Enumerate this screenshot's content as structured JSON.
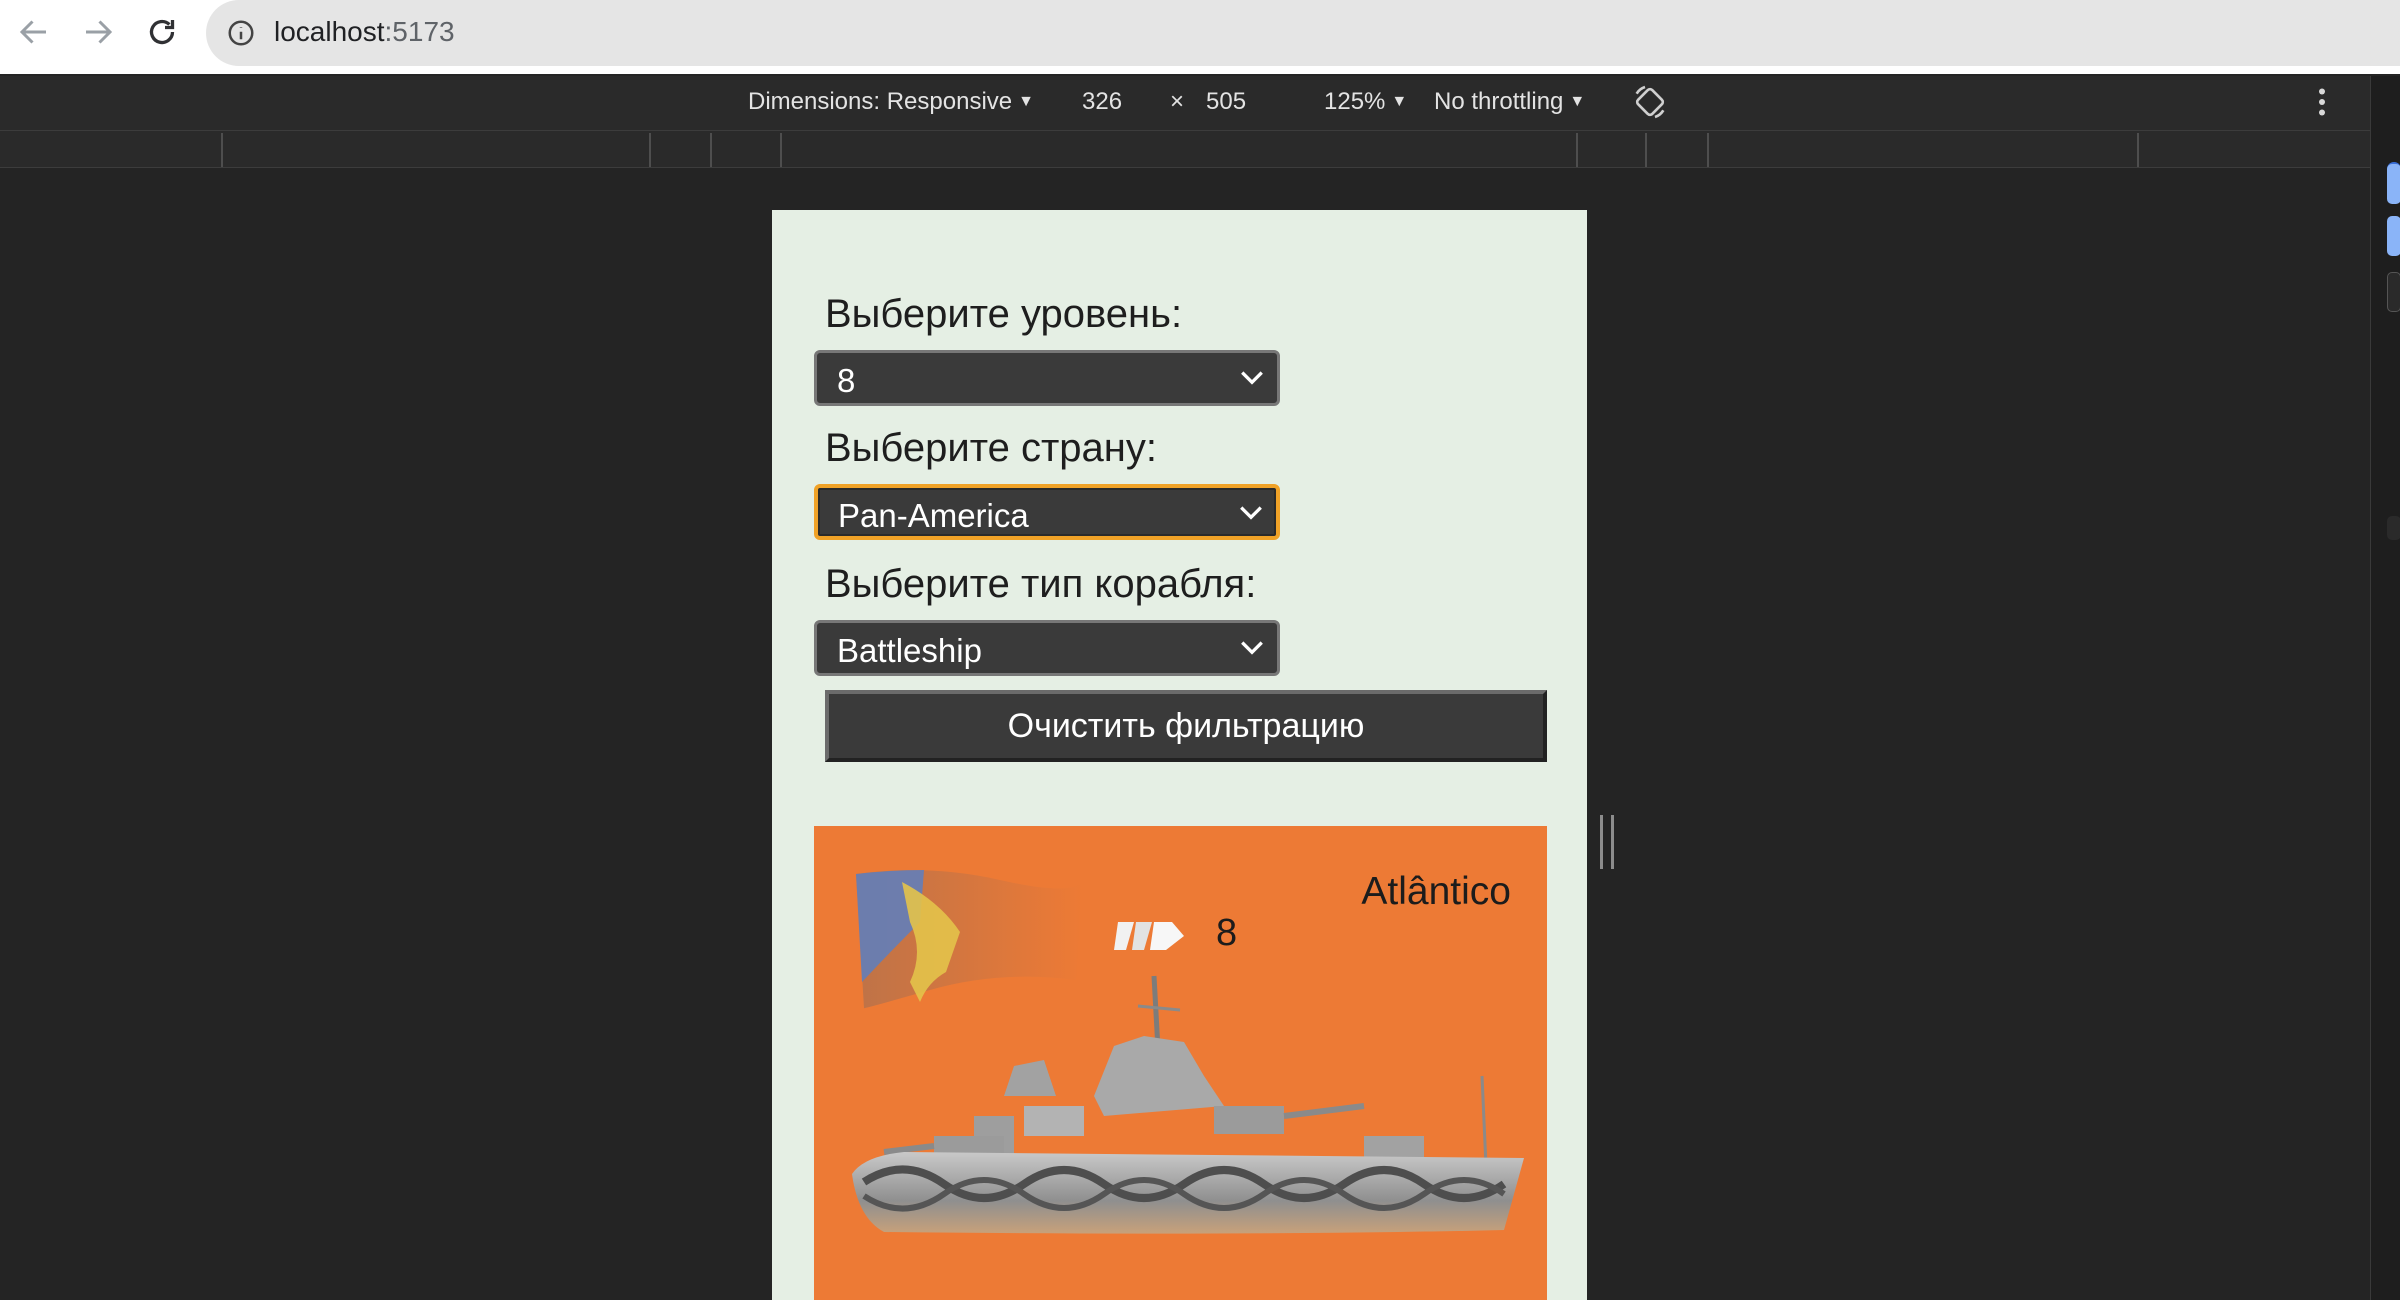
{
  "browser": {
    "url_host": "localhost",
    "url_port": ":5173"
  },
  "devtools": {
    "dimensions_label": "Dimensions: Responsive",
    "width": "326",
    "times": "×",
    "height": "505",
    "zoom": "125%",
    "throttling": "No throttling"
  },
  "filters": {
    "level_label": "Выберите уровень:",
    "level_value": "8",
    "country_label": "Выберите страну:",
    "country_value": "Pan-America",
    "type_label": "Выберите тип корабля:",
    "type_value": "Battleship",
    "clear_button": "Очистить фильтрацию"
  },
  "ship": {
    "name": "Atlântico",
    "tier": "8",
    "card_color": "#ed7a35"
  },
  "colors": {
    "page_bg": "#e5efe4",
    "select_bg": "#3a3a3a",
    "focus_ring": "#f0a227"
  }
}
